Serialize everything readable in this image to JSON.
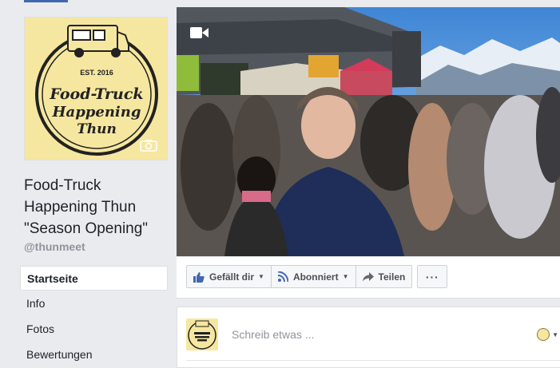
{
  "page": {
    "name_lines": [
      "Food-Truck",
      "Happening Thun",
      "\"Season Opening\""
    ],
    "handle": "@thunmeet"
  },
  "logo": {
    "est": "EST. 2016",
    "line1": "Food-Truck",
    "line2": "Happening",
    "line3": "Thun"
  },
  "sidebar": {
    "items": [
      {
        "label": "Startseite",
        "active": true
      },
      {
        "label": "Info",
        "active": false
      },
      {
        "label": "Fotos",
        "active": false
      },
      {
        "label": "Bewertungen",
        "active": false
      }
    ]
  },
  "actions": {
    "like_label": "Gefällt dir",
    "follow_label": "Abonniert",
    "share_label": "Teilen",
    "more_label": "···"
  },
  "composer": {
    "placeholder": "Schreib etwas ..."
  },
  "colors": {
    "brand_blue": "#4267b2",
    "logo_bg": "#f6e7a0"
  },
  "icons": {
    "video": "video-camera-icon",
    "camera": "camera-icon",
    "like": "thumbs-up-icon",
    "follow": "rss-icon",
    "share": "share-arrow-icon"
  }
}
